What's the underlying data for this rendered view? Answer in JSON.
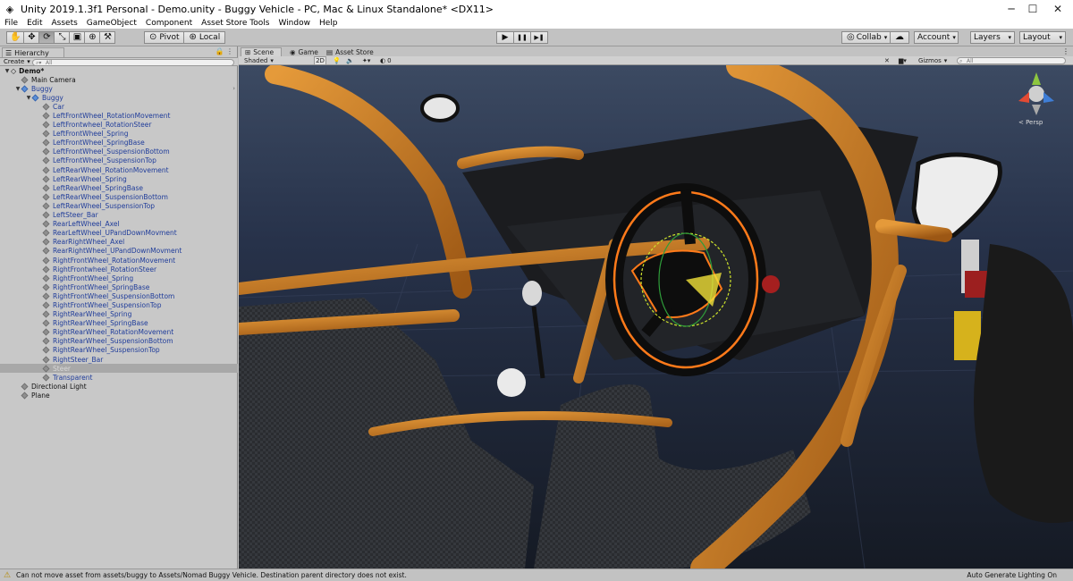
{
  "window": {
    "title": "Unity 2019.1.3f1 Personal - Demo.unity - Buggy Vehicle - PC, Mac & Linux Standalone* <DX11>",
    "minimize": "─",
    "maximize": "☐",
    "close": "✕"
  },
  "menu": [
    "File",
    "Edit",
    "Assets",
    "GameObject",
    "Component",
    "Asset Store Tools",
    "Window",
    "Help"
  ],
  "toolbar": {
    "pivot": "Pivot",
    "local": "Local",
    "collab": "Collab",
    "account": "Account",
    "layers": "Layers",
    "layout": "Layout",
    "play": "▶",
    "pause": "❚❚",
    "step": "▶❚"
  },
  "hierarchy": {
    "tab": "Hierarchy",
    "create": "Create",
    "search_placeholder": "All",
    "rows": [
      {
        "label": "Demo*",
        "indent": 0,
        "arrow": "▼",
        "icon": "unity",
        "bold": true
      },
      {
        "label": "Main Camera",
        "indent": 1,
        "icon": "cube"
      },
      {
        "label": "Buggy",
        "indent": 1,
        "arrow": "▼",
        "icon": "cube-blue",
        "blue": true,
        "chevron": "›"
      },
      {
        "label": "Buggy",
        "indent": 2,
        "arrow": "▼",
        "icon": "cube-blue",
        "blue": true
      },
      {
        "label": "Car",
        "indent": 3,
        "icon": "cube",
        "blue": true
      },
      {
        "label": "LeftFrontWheel_RotationMovement",
        "indent": 3,
        "icon": "cube",
        "blue": true
      },
      {
        "label": "LeftFrontwheel_RotationSteer",
        "indent": 3,
        "icon": "cube",
        "blue": true
      },
      {
        "label": "LeftFrontWheel_Spring",
        "indent": 3,
        "icon": "cube",
        "blue": true
      },
      {
        "label": "LeftFrontWheel_SpringBase",
        "indent": 3,
        "icon": "cube",
        "blue": true
      },
      {
        "label": "LeftFrontWheel_SuspensionBottom",
        "indent": 3,
        "icon": "cube",
        "blue": true
      },
      {
        "label": "LeftFrontWheel_SuspensionTop",
        "indent": 3,
        "icon": "cube",
        "blue": true
      },
      {
        "label": "LeftRearWheel_RotationMovement",
        "indent": 3,
        "icon": "cube",
        "blue": true
      },
      {
        "label": "LeftRearWheel_Spring",
        "indent": 3,
        "icon": "cube",
        "blue": true
      },
      {
        "label": "LeftRearWheel_SpringBase",
        "indent": 3,
        "icon": "cube",
        "blue": true
      },
      {
        "label": "LeftRearWheel_SuspensionBottom",
        "indent": 3,
        "icon": "cube",
        "blue": true
      },
      {
        "label": "LeftRearWheel_SuspensionTop",
        "indent": 3,
        "icon": "cube",
        "blue": true
      },
      {
        "label": "LeftSteer_Bar",
        "indent": 3,
        "icon": "cube",
        "blue": true
      },
      {
        "label": "RearLeftWheel_Axel",
        "indent": 3,
        "icon": "cube",
        "blue": true
      },
      {
        "label": "RearLeftWheel_UPandDownMovment",
        "indent": 3,
        "icon": "cube",
        "blue": true
      },
      {
        "label": "RearRightWheel_Axel",
        "indent": 3,
        "icon": "cube",
        "blue": true
      },
      {
        "label": "RearRightWheel_UPandDownMovment",
        "indent": 3,
        "icon": "cube",
        "blue": true
      },
      {
        "label": "RightFrontWheel_RotationMovement",
        "indent": 3,
        "icon": "cube",
        "blue": true
      },
      {
        "label": "RightFrontwheel_RotationSteer",
        "indent": 3,
        "icon": "cube",
        "blue": true
      },
      {
        "label": "RightFrontWheel_Spring",
        "indent": 3,
        "icon": "cube",
        "blue": true
      },
      {
        "label": "RightFrontWheel_SpringBase",
        "indent": 3,
        "icon": "cube",
        "blue": true
      },
      {
        "label": "RightFrontWheel_SuspensionBottom",
        "indent": 3,
        "icon": "cube",
        "blue": true
      },
      {
        "label": "RightFrontWheel_SuspensionTop",
        "indent": 3,
        "icon": "cube",
        "blue": true
      },
      {
        "label": "RightRearWheel_Spring",
        "indent": 3,
        "icon": "cube",
        "blue": true
      },
      {
        "label": "RightRearWheel_SpringBase",
        "indent": 3,
        "icon": "cube",
        "blue": true
      },
      {
        "label": "RightRearWheel_RotationMovement",
        "indent": 3,
        "icon": "cube",
        "blue": true
      },
      {
        "label": "RightRearWheel_SuspensionBottom",
        "indent": 3,
        "icon": "cube",
        "blue": true
      },
      {
        "label": "RightRearWheel_SuspensionTop",
        "indent": 3,
        "icon": "cube",
        "blue": true
      },
      {
        "label": "RightSteer_Bar",
        "indent": 3,
        "icon": "cube",
        "blue": true
      },
      {
        "label": "Steer",
        "indent": 3,
        "icon": "cube",
        "blue": true,
        "selected": true
      },
      {
        "label": "Transparent",
        "indent": 3,
        "icon": "cube",
        "blue": true
      },
      {
        "label": "Directional Light",
        "indent": 1,
        "icon": "cube"
      },
      {
        "label": "Plane",
        "indent": 1,
        "icon": "cube"
      }
    ]
  },
  "scene": {
    "tabs": [
      "Scene",
      "Game",
      "Asset Store"
    ],
    "shading": "Shaded",
    "mode_2d": "2D",
    "fx_count": "0",
    "gizmos": "Gizmos",
    "search_placeholder": "All",
    "persp_label": "< Persp"
  },
  "status": {
    "message": "Can not move asset from assets/buggy to Assets/Nomad Buggy Vehicle. Destination parent directory does not exist.",
    "right": "Auto Generate Lighting On"
  },
  "colors": {
    "rollcage": "#c9781f",
    "selection_outline": "#ff7a1a",
    "background": "#1d2533"
  }
}
